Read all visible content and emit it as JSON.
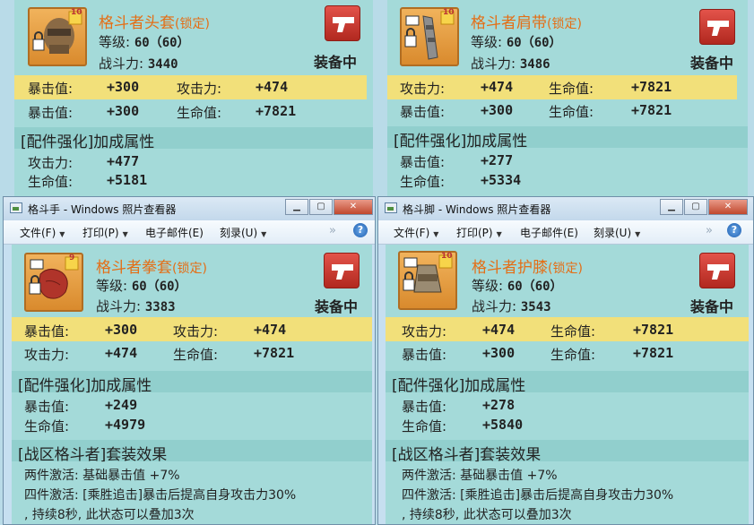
{
  "window_common": {
    "menu": {
      "file": "文件(F)",
      "print": "打印(P)",
      "email": "电子邮件(E)",
      "burn": "刻录(U)"
    },
    "help": "?",
    "equipped": "装备中",
    "level_label": "等级:",
    "power_label": "战斗力:",
    "enhance_header": "[配件强化]加成属性",
    "set_header": "[战区格斗者]套装效果",
    "set_two": "两件激活: 基础暴击值 +7%",
    "set_four": "四件激活: [乘胜追击]暴击后提高自身攻击力30%",
    "set_four_cont": ", 持续8秒, 此状态可以叠加3次"
  },
  "items": {
    "helmet": {
      "name": "格斗者头套",
      "lock": "(锁定)",
      "stars": "10",
      "level": "60（60）",
      "power": "3440",
      "stats": [
        [
          "暴击值:",
          "+300",
          "攻击力:",
          "+474"
        ],
        [
          "暴击值:",
          "+300",
          "生命值:",
          "+7821"
        ]
      ],
      "bonus": [
        [
          "攻击力:",
          "+477"
        ],
        [
          "生命值:",
          "+5181"
        ]
      ]
    },
    "belt": {
      "name": "格斗者肩带",
      "lock": "(锁定)",
      "stars": "10",
      "level": "60（60）",
      "power": "3486",
      "stats": [
        [
          "攻击力:",
          "+474",
          "生命值:",
          "+7821"
        ],
        [
          "暴击值:",
          "+300",
          "生命值:",
          "+7821"
        ]
      ],
      "bonus": [
        [
          "暴击值:",
          "+277"
        ],
        [
          "生命值:",
          "+5334"
        ]
      ]
    },
    "gloves": {
      "title": "格斗手 - Windows 照片查看器",
      "name": "格斗者拳套",
      "lock": "(锁定)",
      "stars": "9",
      "level": "60（60）",
      "power": "3383",
      "stats": [
        [
          "暴击值:",
          "+300",
          "攻击力:",
          "+474"
        ],
        [
          "攻击力:",
          "+474",
          "生命值:",
          "+7821"
        ]
      ],
      "bonus": [
        [
          "暴击值:",
          "+249"
        ],
        [
          "生命值:",
          "+4979"
        ]
      ]
    },
    "kneepads": {
      "title": "格斗脚 - Windows 照片查看器",
      "name": "格斗者护膝",
      "lock": "(锁定)",
      "stars": "10",
      "level": "60（60）",
      "power": "3543",
      "stats": [
        [
          "攻击力:",
          "+474",
          "生命值:",
          "+7821"
        ],
        [
          "暴击值:",
          "+300",
          "生命值:",
          "+7821"
        ]
      ],
      "bonus": [
        [
          "暴击值:",
          "+278"
        ],
        [
          "生命值:",
          "+5840"
        ]
      ]
    }
  }
}
